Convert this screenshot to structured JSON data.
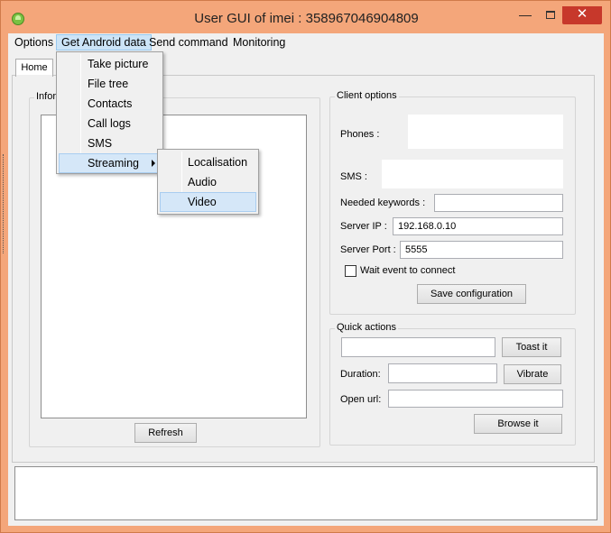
{
  "window": {
    "title": "User GUI of imei : 358967046904809",
    "minimize_glyph": "—",
    "close_glyph": "✕"
  },
  "menubar": {
    "options": "Options",
    "get_android_data": "Get Android data",
    "send_command": "Send command",
    "monitoring": "Monitoring"
  },
  "android_menu": {
    "items": [
      "Take picture",
      "File tree",
      "Contacts",
      "Call logs",
      "SMS",
      "Streaming"
    ]
  },
  "streaming_submenu": {
    "items": [
      "Localisation",
      "Audio",
      "Video"
    ]
  },
  "tabs": {
    "home": "Home"
  },
  "info_group": {
    "title": "Infor",
    "refresh_label": "Refresh"
  },
  "client_options": {
    "title": "Client options",
    "phones_label": "Phones :",
    "sms_label": "SMS :",
    "keywords_label": "Needed keywords :",
    "keywords_value": "",
    "server_ip_label": "Server IP :",
    "server_ip_value": "192.168.0.10",
    "server_port_label": "Server Port :",
    "server_port_value": "5555",
    "wait_event_label": "Wait event to connect",
    "save_label": "Save configuration"
  },
  "quick_actions": {
    "title": "Quick actions",
    "toast_value": "",
    "toast_label": "Toast it",
    "duration_label": "Duration:",
    "duration_value": "",
    "vibrate_label": "Vibrate",
    "open_url_label": "Open url:",
    "open_url_value": "",
    "browse_label": "Browse it"
  },
  "colors": {
    "titlebar": "#f4a67a",
    "close_button": "#c7382b",
    "menu_highlight": "#cce4f7"
  }
}
